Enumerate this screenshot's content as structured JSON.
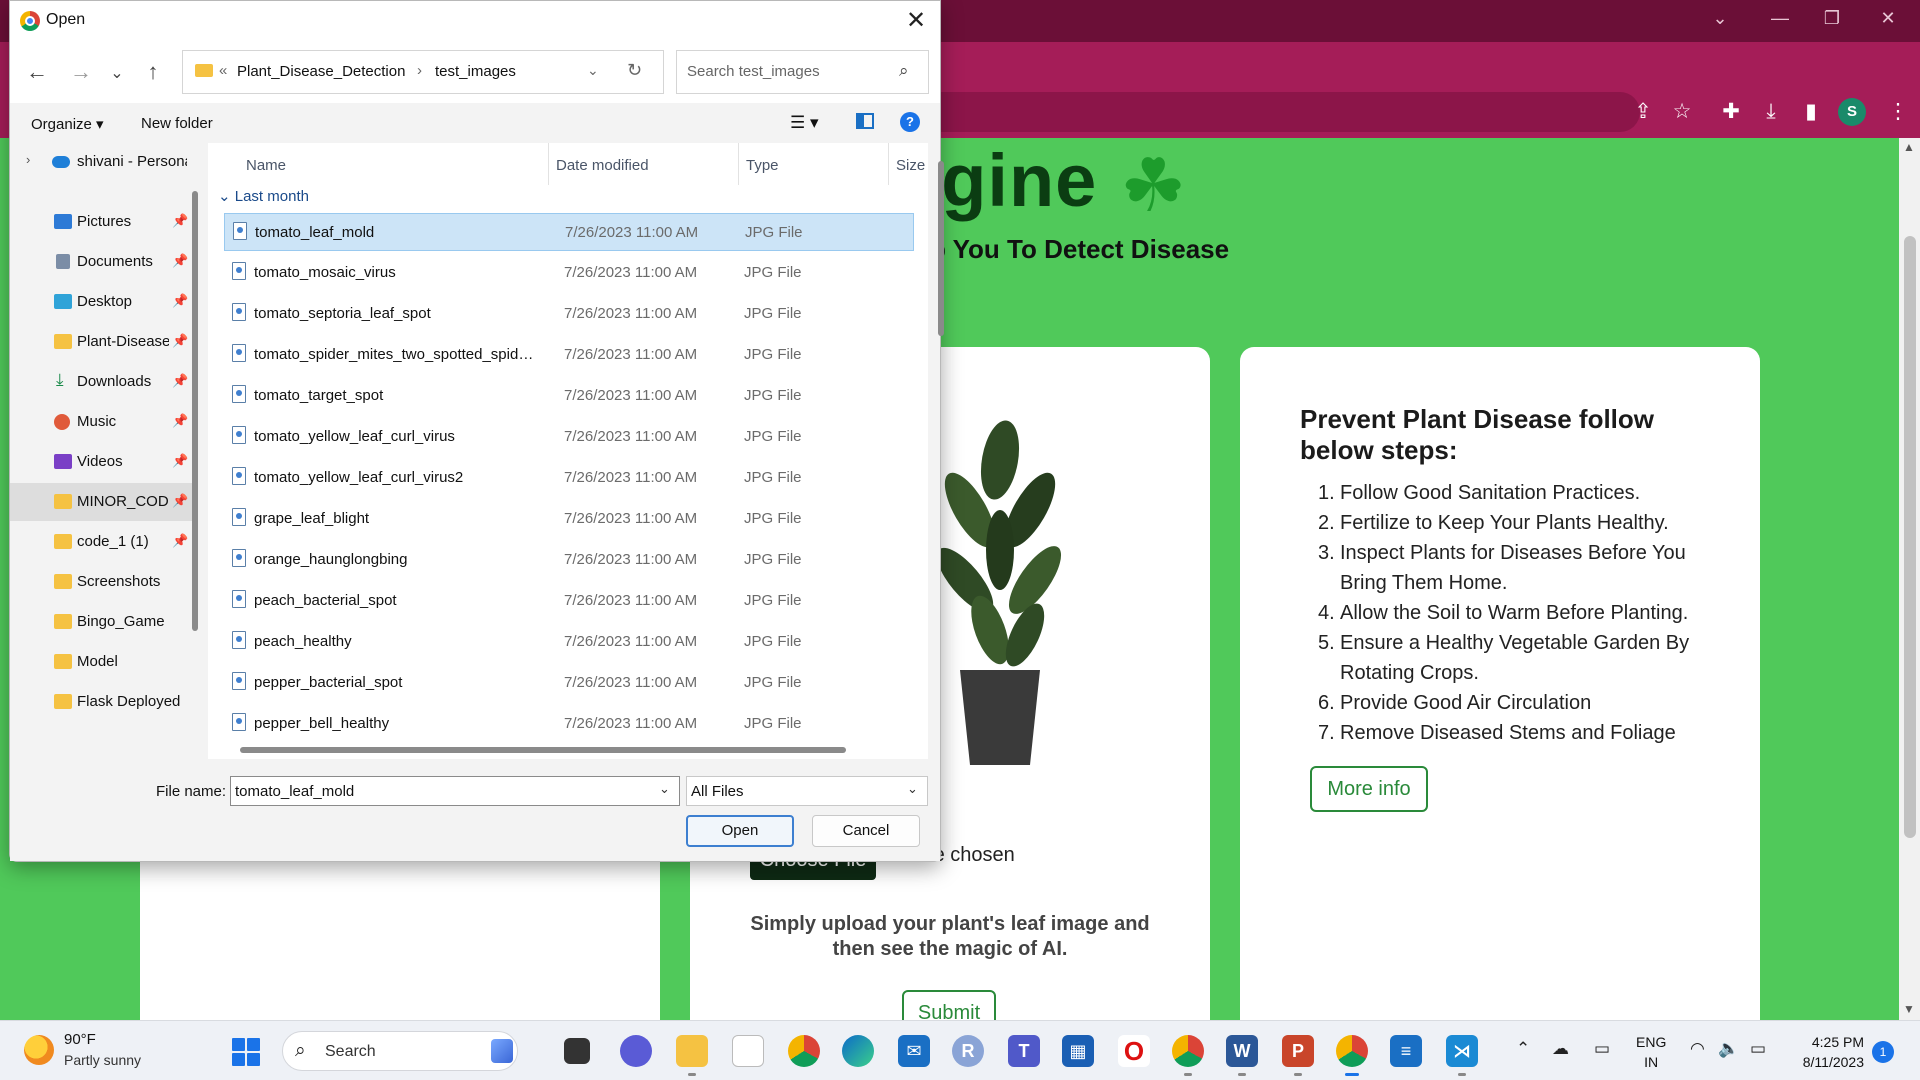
{
  "browser": {
    "toolbar_icons": [
      "share-icon",
      "star-icon",
      "extensions-icon",
      "download-icon",
      "sidebar-icon"
    ],
    "profile_initial": "S",
    "accent_color": "#a51d58"
  },
  "page": {
    "hero_title": "ngine",
    "hero_subtitle": "p You To Detect Disease",
    "choose_file_label": "Choose File",
    "no_file_text": "No file chosen",
    "upload_text": "Simply upload your plant's leaf image and then see the magic of AI.",
    "submit_label": "Submit",
    "steps_heading": "Prevent Plant Disease follow below steps:",
    "steps": [
      {
        "num": "1.",
        "text": "Follow Good Sanitation Practices."
      },
      {
        "num": "2.",
        "text": "Fertilize to Keep Your Plants Healthy."
      },
      {
        "num": "3.",
        "text": "Inspect Plants for Diseases Before You Bring Them Home."
      },
      {
        "num": "4.",
        "text": "Allow the Soil to Warm Before Planting."
      },
      {
        "num": "5.",
        "text": "Ensure a Healthy Vegetable Garden By Rotating Crops."
      },
      {
        "num": "6.",
        "text": "Provide Good Air Circulation"
      },
      {
        "num": "7.",
        "text": "Remove Diseased Stems and Foliage"
      }
    ],
    "more_info_label": "More info",
    "background_color": "#50c95a"
  },
  "dialog": {
    "title": "Open",
    "breadcrumb": {
      "prefix": "«",
      "parent": "Plant_Disease_Detection",
      "sep": "›",
      "current": "test_images"
    },
    "search_placeholder": "Search test_images",
    "organize_label": "Organize ▾",
    "new_folder_label": "New folder",
    "nav_items": [
      {
        "label": "shivani - Persona",
        "icon": "onedrive-icon"
      },
      {
        "label": "Pictures",
        "icon": "pictures-icon"
      },
      {
        "label": "Documents",
        "icon": "documents-icon"
      },
      {
        "label": "Desktop",
        "icon": "desktop-icon"
      },
      {
        "label": "Plant-Disease",
        "icon": "folder-icon"
      },
      {
        "label": "Downloads",
        "icon": "downloads-icon"
      },
      {
        "label": "Music",
        "icon": "music-icon"
      },
      {
        "label": "Videos",
        "icon": "videos-icon"
      },
      {
        "label": "MINOR_COD",
        "icon": "folder-icon"
      },
      {
        "label": "code_1 (1)",
        "icon": "folder-icon"
      },
      {
        "label": "Screenshots",
        "icon": "folder-icon"
      },
      {
        "label": "Bingo_Game",
        "icon": "folder-icon"
      },
      {
        "label": "Model",
        "icon": "folder-icon"
      },
      {
        "label": "Flask Deployed",
        "icon": "folder-icon"
      }
    ],
    "columns": {
      "name": "Name",
      "date": "Date modified",
      "type": "Type",
      "size": "Size"
    },
    "group_label": "Last month",
    "files": [
      {
        "name": "tomato_leaf_mold",
        "date": "7/26/2023 11:00 AM",
        "type": "JPG File"
      },
      {
        "name": "tomato_mosaic_virus",
        "date": "7/26/2023 11:00 AM",
        "type": "JPG File"
      },
      {
        "name": "tomato_septoria_leaf_spot",
        "date": "7/26/2023 11:00 AM",
        "type": "JPG File"
      },
      {
        "name": "tomato_spider_mites_two_spotted_spider...",
        "date": "7/26/2023 11:00 AM",
        "type": "JPG File"
      },
      {
        "name": "tomato_target_spot",
        "date": "7/26/2023 11:00 AM",
        "type": "JPG File"
      },
      {
        "name": "tomato_yellow_leaf_curl_virus",
        "date": "7/26/2023 11:00 AM",
        "type": "JPG File"
      },
      {
        "name": "tomato_yellow_leaf_curl_virus2",
        "date": "7/26/2023 11:00 AM",
        "type": "JPG File"
      },
      {
        "name": "grape_leaf_blight",
        "date": "7/26/2023 11:00 AM",
        "type": "JPG File"
      },
      {
        "name": "orange_haunglongbing",
        "date": "7/26/2023 11:00 AM",
        "type": "JPG File"
      },
      {
        "name": "peach_bacterial_spot",
        "date": "7/26/2023 11:00 AM",
        "type": "JPG File"
      },
      {
        "name": "peach_healthy",
        "date": "7/26/2023 11:00 AM",
        "type": "JPG File"
      },
      {
        "name": "pepper_bacterial_spot",
        "date": "7/26/2023 11:00 AM",
        "type": "JPG File"
      },
      {
        "name": "pepper_bell_healthy",
        "date": "7/26/2023 11:00 AM",
        "type": "JPG File"
      }
    ],
    "selected_file": "tomato_leaf_mold",
    "file_name_label": "File name:",
    "file_name_value": "tomato_leaf_mold",
    "filter_value": "All Files",
    "open_label": "Open",
    "cancel_label": "Cancel"
  },
  "taskbar": {
    "weather_temp": "90°F",
    "weather_desc": "Partly sunny",
    "search_label": "Search",
    "lang_line1": "ENG",
    "lang_line2": "IN",
    "time": "4:25 PM",
    "date": "8/11/2023",
    "notification_count": "1"
  }
}
